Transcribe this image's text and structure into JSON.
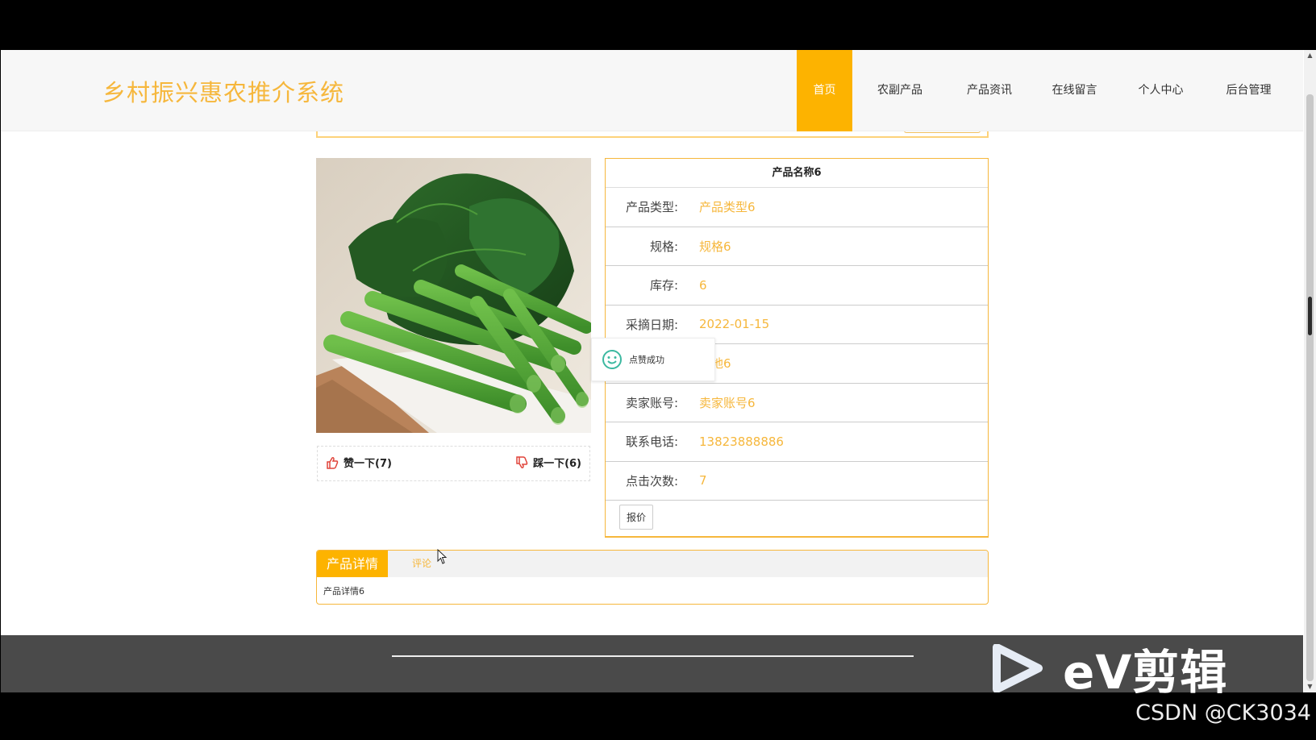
{
  "header": {
    "logo": "乡村振兴惠农推介系统",
    "nav": [
      "首页",
      "农副产品",
      "产品资讯",
      "在线留言",
      "个人中心",
      "后台管理"
    ],
    "active_nav": "首页"
  },
  "product": {
    "name": "产品名称6",
    "fields": [
      {
        "label": "产品类型:",
        "value": "产品类型6"
      },
      {
        "label": "规格:",
        "value": "规格6"
      },
      {
        "label": "库存:",
        "value": "6"
      },
      {
        "label": "采摘日期:",
        "value": "2022-01-15"
      },
      {
        "label": "",
        "value": "产地6"
      },
      {
        "label": "卖家账号:",
        "value": "卖家账号6"
      },
      {
        "label": "联系电话:",
        "value": "13823888886"
      },
      {
        "label": "点击次数:",
        "value": "7"
      }
    ],
    "quote_button": "报价"
  },
  "votes": {
    "like_label": "赞一下(7)",
    "dislike_label": "踩一下(6)"
  },
  "toast": {
    "message": "点赞成功"
  },
  "tabs": {
    "items": [
      "产品详情",
      "评论"
    ],
    "active": "产品详情",
    "content": "产品详情6"
  },
  "overlays": {
    "editor_watermark": "eV剪辑",
    "credit": "CSDN @CK3034"
  },
  "colors": {
    "accent": "#fdb300",
    "accent_text": "#f6b73c",
    "footer": "#4a4a4a",
    "toast_icon": "#3cb8a0"
  }
}
